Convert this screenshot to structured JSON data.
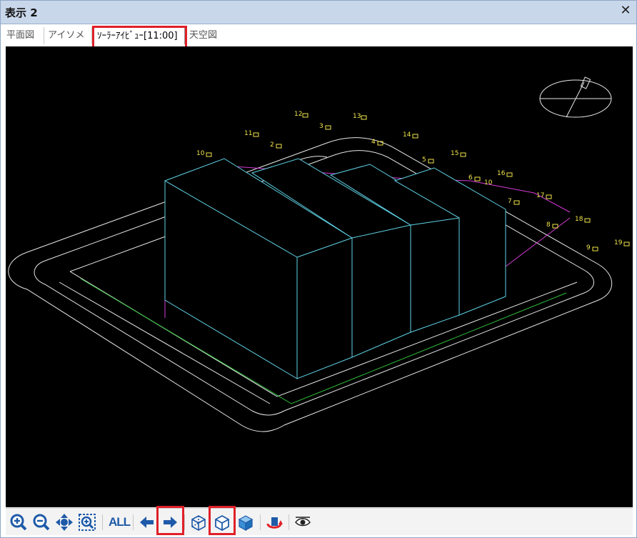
{
  "window": {
    "title": "表示 2",
    "close_glyph": "✕"
  },
  "tabs": [
    {
      "label": "平面図",
      "active": false
    },
    {
      "label": "アイソメ図",
      "active": false
    },
    {
      "label": "ｿｰﾗｰｱｲﾋﾞｭｰ[11:00]",
      "active": true
    },
    {
      "label": "天空図",
      "active": false
    }
  ],
  "viewport": {
    "background": "#000000",
    "point_labels": [
      "12",
      "13",
      "3",
      "11",
      "2",
      "4",
      "14",
      "10",
      "15",
      "5",
      "16",
      "6",
      "10",
      "7",
      "17",
      "8",
      "18",
      "9",
      "19"
    ]
  },
  "toolbar": {
    "buttons": [
      {
        "name": "zoom-in-icon"
      },
      {
        "name": "zoom-out-icon"
      },
      {
        "name": "pan-icon"
      },
      {
        "name": "zoom-window-icon"
      },
      {
        "name": "zoom-all-button",
        "label": "ALL"
      },
      {
        "name": "prev-arrow-icon"
      },
      {
        "name": "next-arrow-icon"
      },
      {
        "name": "wireframe-box-icon"
      },
      {
        "name": "hidden-line-box-icon"
      },
      {
        "name": "shaded-box-icon"
      },
      {
        "name": "rotate-icon"
      },
      {
        "name": "eye-view-icon"
      }
    ],
    "all_label": "ALL"
  },
  "colors": {
    "highlight": "#e02028",
    "accent_blue": "#1e5aa8",
    "cyan_lines": "#5fd3e6",
    "magenta_lines": "#d63ad6",
    "green_lines": "#2fbf3a",
    "label_yellow": "#f2e64a"
  }
}
